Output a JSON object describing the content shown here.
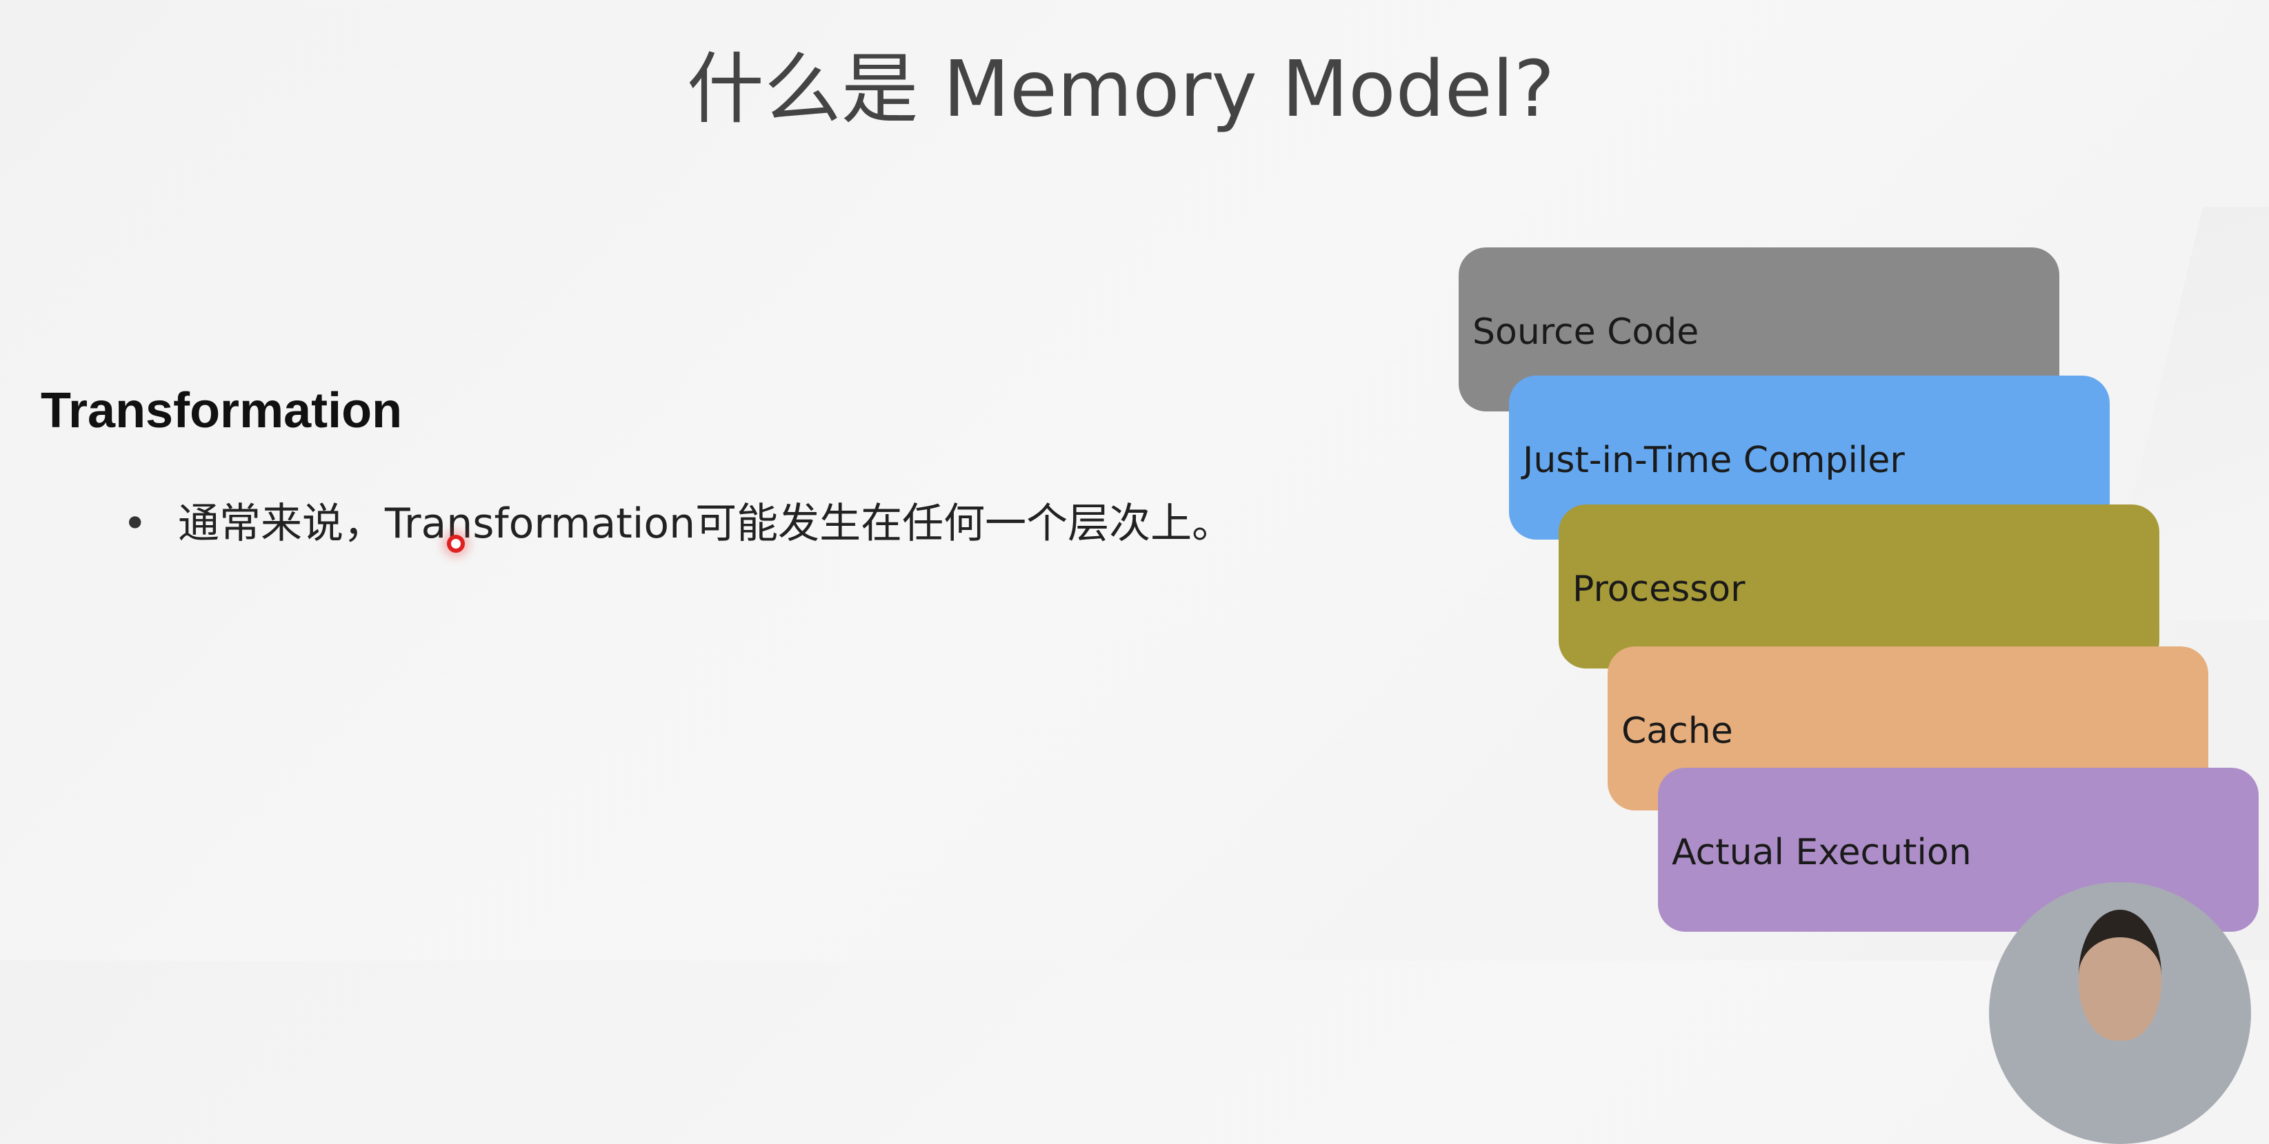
{
  "slide": {
    "title": "什么是 Memory Model?",
    "heading": "Transformation",
    "bullets": [
      "通常来说，Transformation可能发生在任何一个层次上。"
    ]
  },
  "layers": [
    {
      "label": "Source Code",
      "color": "#898989"
    },
    {
      "label": "Just-in-Time Compiler",
      "color": "#65a8f0"
    },
    {
      "label": "Processor",
      "color": "#a79a38"
    },
    {
      "label": "Cache",
      "color": "#e6ae7c"
    },
    {
      "label": "Actual Execution",
      "color": "#ad8ec8"
    }
  ]
}
